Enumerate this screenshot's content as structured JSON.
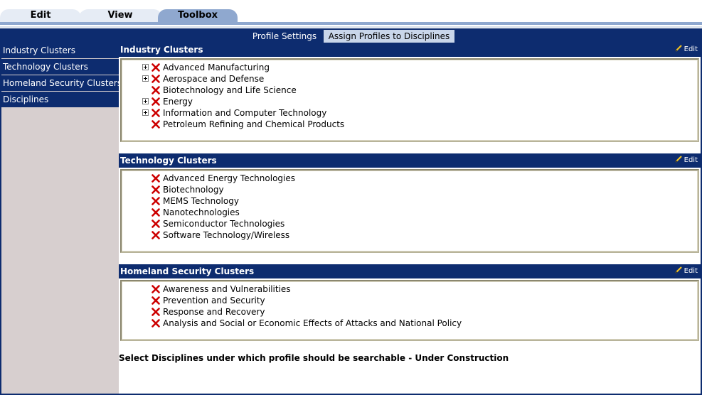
{
  "top_tabs": [
    "Edit",
    "View",
    "Toolbox"
  ],
  "sub_tabs": [
    "Profile Settings",
    "Assign Profiles to Disciplines"
  ],
  "sidebar": {
    "items": [
      {
        "label": "Industry Clusters"
      },
      {
        "label": "Technology Clusters"
      },
      {
        "label": "Homeland Security Clusters"
      },
      {
        "label": "Disciplines"
      }
    ]
  },
  "edit_label": "Edit",
  "sections": [
    {
      "title": "Industry Clusters",
      "items": [
        {
          "label": "Advanced Manufacturing",
          "expandable": true
        },
        {
          "label": "Aerospace and Defense",
          "expandable": true
        },
        {
          "label": "Biotechnology and Life Science",
          "expandable": false
        },
        {
          "label": "Energy",
          "expandable": true
        },
        {
          "label": "Information and Computer Technology",
          "expandable": true
        },
        {
          "label": "Petroleum Refining and Chemical Products",
          "expandable": false
        }
      ]
    },
    {
      "title": "Technology Clusters",
      "items": [
        {
          "label": "Advanced Energy Technologies",
          "expandable": false
        },
        {
          "label": "Biotechnology",
          "expandable": false
        },
        {
          "label": "MEMS Technology",
          "expandable": false
        },
        {
          "label": "Nanotechnologies",
          "expandable": false
        },
        {
          "label": "Semiconductor Technologies",
          "expandable": false
        },
        {
          "label": "Software Technology/Wireless",
          "expandable": false
        }
      ]
    },
    {
      "title": "Homeland Security Clusters",
      "items": [
        {
          "label": "Awareness and Vulnerabilities",
          "expandable": false
        },
        {
          "label": "Prevention and Security",
          "expandable": false
        },
        {
          "label": "Response and Recovery",
          "expandable": false
        },
        {
          "label": "Analysis and Social or Economic Effects of Attacks and National Policy",
          "expandable": false
        }
      ]
    }
  ],
  "footnote": "Select Disciplines under which profile should be searchable - Under Construction",
  "icons": {
    "remove": "red-x-icon",
    "expand": "plus-box-icon",
    "edit": "pencil-icon"
  },
  "colors": {
    "nav_bg": "#0d2c6f",
    "active_tab": "#8fa8cf",
    "remove_x": "#cc0000"
  }
}
